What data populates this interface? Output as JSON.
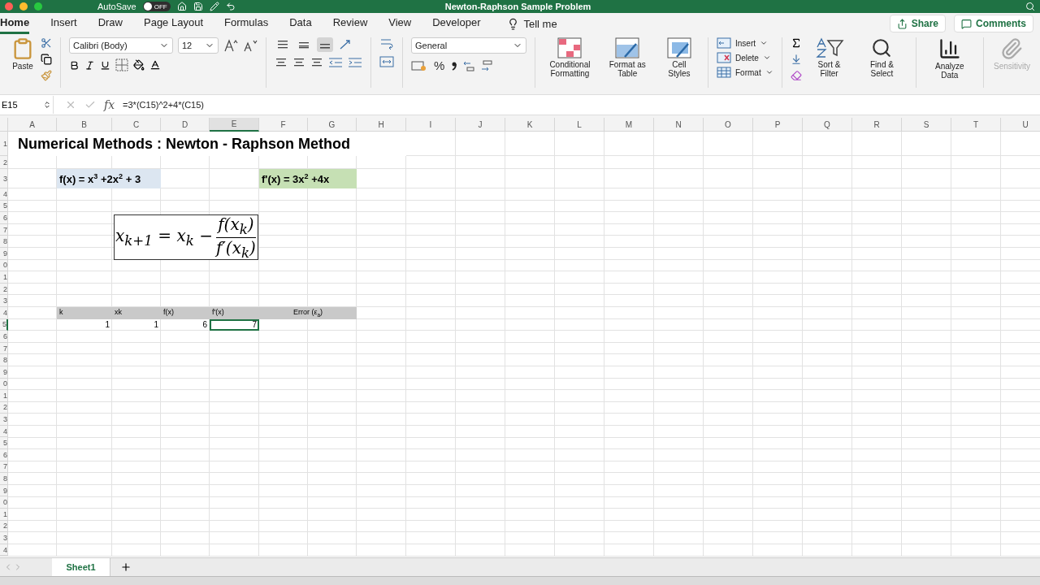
{
  "title_bar": {
    "autosave": "AutoSave",
    "autosave_toggle": {
      "label": "OFF",
      "on": false
    },
    "title": "Newton-Raphson Sample Problem"
  },
  "ribbon_tabs": [
    {
      "label": "Home",
      "selected": true
    },
    {
      "label": "Insert",
      "selected": false
    },
    {
      "label": "Draw",
      "selected": false
    },
    {
      "label": "Page Layout",
      "selected": false
    },
    {
      "label": "Formulas",
      "selected": false
    },
    {
      "label": "Data",
      "selected": false
    },
    {
      "label": "Review",
      "selected": false
    },
    {
      "label": "View",
      "selected": false
    },
    {
      "label": "Developer",
      "selected": false
    }
  ],
  "tell_me": "Tell me",
  "share": "Share",
  "comments": "Comments",
  "ribbon": {
    "paste": "Paste",
    "font_name": "Calibri (Body)",
    "font_size": "12",
    "vertical_align": [
      {
        "selected": false
      },
      {
        "selected": false
      },
      {
        "selected": true
      }
    ],
    "number_format": "General",
    "percent": "%",
    "styles": [
      {
        "label": "Conditional Formatting",
        "kind": "conditional"
      },
      {
        "label": "Format as Table",
        "kind": "table"
      },
      {
        "label": "Cell Styles",
        "kind": "styles"
      }
    ],
    "cells": [
      {
        "label": "Insert",
        "kind": "insert"
      },
      {
        "label": "Delete",
        "kind": "delete"
      },
      {
        "label": "Format",
        "kind": "format"
      }
    ],
    "editing": [
      {
        "label": "Sort & Filter",
        "kind": "sort"
      },
      {
        "label": "Find & Select",
        "kind": "find"
      }
    ],
    "analyze": "Analyze Data",
    "sensitivity": {
      "label": "Sensitivity",
      "disabled": true
    }
  },
  "formula_bar": {
    "name_box": "E15",
    "fx": "fx",
    "formula": "=3*(C15)^2+4*(C15)"
  },
  "sheet": {
    "columns": [
      {
        "label": "A",
        "selected": false
      },
      {
        "label": "B",
        "selected": false
      },
      {
        "label": "C",
        "selected": false
      },
      {
        "label": "D",
        "selected": false
      },
      {
        "label": "E",
        "selected": true
      },
      {
        "label": "F",
        "selected": false
      },
      {
        "label": "G",
        "selected": false
      },
      {
        "label": "H",
        "selected": false
      },
      {
        "label": "I",
        "selected": false
      },
      {
        "label": "J",
        "selected": false
      },
      {
        "label": "K",
        "selected": false
      },
      {
        "label": "L",
        "selected": false
      },
      {
        "label": "M",
        "selected": false
      },
      {
        "label": "N",
        "selected": false
      },
      {
        "label": "O",
        "selected": false
      },
      {
        "label": "P",
        "selected": false
      },
      {
        "label": "Q",
        "selected": false
      },
      {
        "label": "R",
        "selected": false
      },
      {
        "label": "S",
        "selected": false
      },
      {
        "label": "T",
        "selected": false
      },
      {
        "label": "U",
        "selected": false
      }
    ],
    "rows": [
      {
        "label": "1",
        "selected": false
      },
      {
        "label": "2",
        "selected": false
      },
      {
        "label": "3",
        "selected": false
      },
      {
        "label": "4",
        "selected": false
      },
      {
        "label": "5",
        "selected": false
      },
      {
        "label": "6",
        "selected": false
      },
      {
        "label": "7",
        "selected": false
      },
      {
        "label": "8",
        "selected": false
      },
      {
        "label": "9",
        "selected": false
      },
      {
        "label": "0",
        "selected": false
      },
      {
        "label": "1",
        "selected": false
      },
      {
        "label": "2",
        "selected": false
      },
      {
        "label": "3",
        "selected": false
      },
      {
        "label": "4",
        "selected": false
      },
      {
        "label": "5",
        "selected": true
      },
      {
        "label": "6",
        "selected": false
      },
      {
        "label": "7",
        "selected": false
      },
      {
        "label": "8",
        "selected": false
      },
      {
        "label": "9",
        "selected": false
      },
      {
        "label": "0",
        "selected": false
      },
      {
        "label": "1",
        "selected": false
      },
      {
        "label": "2",
        "selected": false
      },
      {
        "label": "3",
        "selected": false
      },
      {
        "label": "4",
        "selected": false
      },
      {
        "label": "5",
        "selected": false
      },
      {
        "label": "6",
        "selected": false
      },
      {
        "label": "7",
        "selected": false
      },
      {
        "label": "8",
        "selected": false
      },
      {
        "label": "9",
        "selected": false
      },
      {
        "label": "0",
        "selected": false
      },
      {
        "label": "1",
        "selected": false
      },
      {
        "label": "2",
        "selected": false
      },
      {
        "label": "3",
        "selected": false
      },
      {
        "label": "4",
        "selected": false
      }
    ],
    "cells": [
      {
        "kind": "title",
        "text": "Numerical Methods : Newton - Raphson Method",
        "selected": false
      },
      {
        "kind": "fill",
        "color": "#dce6f1",
        "text": "f(x) = x$^{3}$ +2x$^{2}$ + 3",
        "selected": false
      },
      {
        "kind": "fill",
        "color": "#c6e0b4",
        "text": "f'(x) = 3x$^{2}$ +4x",
        "selected": false
      },
      {
        "kind": "header",
        "text": "k",
        "selected": false
      },
      {
        "kind": "header",
        "text": "xk",
        "selected": false
      },
      {
        "kind": "header",
        "text": "f(x)",
        "selected": false
      },
      {
        "kind": "header",
        "text": "f'(x)",
        "selected": false
      },
      {
        "kind": "header",
        "text": "Error (ε$_{a}$)",
        "selected": false
      },
      {
        "kind": "number",
        "text": "1",
        "selected": false
      },
      {
        "kind": "number",
        "text": "1",
        "selected": false
      },
      {
        "kind": "number",
        "text": "6",
        "selected": false
      },
      {
        "kind": "number",
        "text": "7",
        "selected": true
      }
    ],
    "equation": {
      "lhs": "x$_{k+1}$ = x$_{k}$ −",
      "numerator": "f(x$_{k}$)",
      "denominator": "f′(x$_{k}$)"
    }
  },
  "sheet_tabs": [
    {
      "label": "Sheet1",
      "selected": true
    }
  ]
}
